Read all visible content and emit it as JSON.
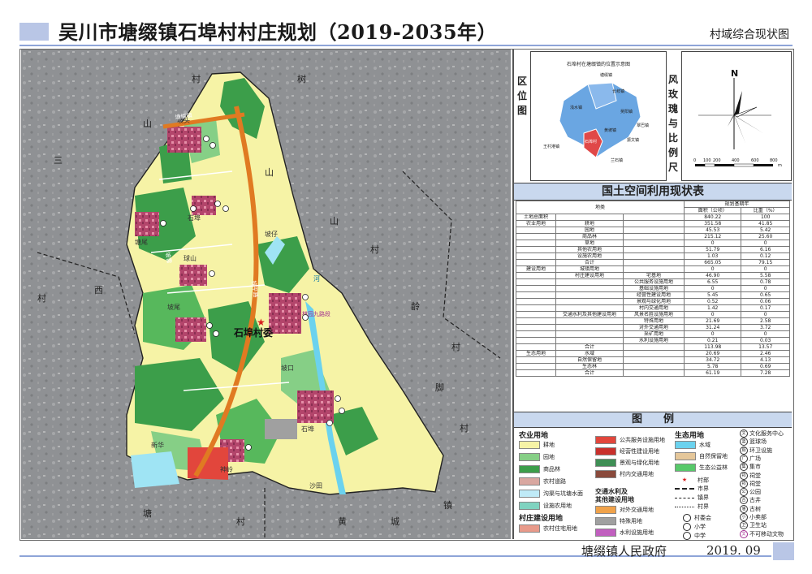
{
  "header": {
    "title": "吴川市塘缀镇石埠村村庄规划（2019-2035年）",
    "subtitle": "村域综合现状图"
  },
  "map": {
    "village_name": "石埠村委",
    "background_labels": [
      "村",
      "树",
      "山",
      "山",
      "山",
      "村",
      "村",
      "西",
      "龄",
      "村",
      "脚",
      "村",
      "塘",
      "村",
      "黄",
      "城",
      "镇",
      "三"
    ],
    "place_labels": [
      "坡头",
      "石埠",
      "塘尾",
      "球山",
      "坡尾",
      "坡仔",
      "坡口",
      "石埠",
      "新华",
      "神岭",
      "沙田"
    ],
    "river_label": "河",
    "road_labels": [
      "塘缀镇",
      "坡雷",
      "桂平路",
      "林园九路段"
    ],
    "colors": {
      "farmland": "#f6f3a6",
      "garden": "#86cf86",
      "forest": "#3c9e4a",
      "water": "#9fe4f4",
      "residential": "#b3456b",
      "road": "#e07a22",
      "outside": "#8f9194"
    }
  },
  "location": {
    "label_chars": [
      "区",
      "位",
      "图"
    ],
    "inset_title": "石埠村在塘缀镇的位置示意图",
    "places": [
      "塘缀镇",
      "长岐镇",
      "浅水镇",
      "吴阳镇",
      "覃巴镇",
      "振文镇",
      "黄坡镇",
      "王村港镇",
      "兰石镇",
      "石埠村"
    ]
  },
  "scale": {
    "label_chars": [
      "风",
      "玫",
      "瑰",
      "与",
      "比",
      "例",
      "尺"
    ],
    "north": "N",
    "ticks": [
      "0",
      "100",
      "200",
      "400",
      "600",
      "800"
    ],
    "unit": "m"
  },
  "table": {
    "title": "国土空间利用现状表",
    "col_header": "地类",
    "year_header": "规划基期年",
    "area_header": "面积（公顷）",
    "ratio_header": "比重（%）",
    "rows": [
      {
        "c1": "土地总面积",
        "c2": "",
        "c3": "",
        "area": "840.22",
        "ratio": "100"
      },
      {
        "c1": "农业用地",
        "c2": "耕地",
        "c3": "",
        "area": "351.58",
        "ratio": "41.85"
      },
      {
        "c1": "",
        "c2": "园地",
        "c3": "",
        "area": "45.53",
        "ratio": "5.42"
      },
      {
        "c1": "",
        "c2": "商品林",
        "c3": "",
        "area": "215.12",
        "ratio": "25.60"
      },
      {
        "c1": "",
        "c2": "草地",
        "c3": "",
        "area": "0",
        "ratio": "0"
      },
      {
        "c1": "",
        "c2": "其他农用地",
        "c3": "",
        "area": "51.79",
        "ratio": "6.16"
      },
      {
        "c1": "",
        "c2": "设施农用地",
        "c3": "",
        "area": "1.03",
        "ratio": "0.12"
      },
      {
        "c1": "",
        "c2": "合计",
        "c3": "",
        "area": "665.05",
        "ratio": "79.15"
      },
      {
        "c1": "建设用地",
        "c2": "城镇用地",
        "c3": "",
        "area": "0",
        "ratio": "0"
      },
      {
        "c1": "",
        "c2": "村庄建设用地",
        "c3": "宅基地",
        "area": "46.90",
        "ratio": "5.58"
      },
      {
        "c1": "",
        "c2": "",
        "c3": "公共服务设施用地",
        "area": "6.55",
        "ratio": "0.78"
      },
      {
        "c1": "",
        "c2": "",
        "c3": "基础设施用地",
        "area": "0",
        "ratio": "0"
      },
      {
        "c1": "",
        "c2": "",
        "c3": "经营性建设用地",
        "area": "5.45",
        "ratio": "0.65"
      },
      {
        "c1": "",
        "c2": "",
        "c3": "景观与绿化用地",
        "area": "0.52",
        "ordinal": "",
        "ratio": "0.06"
      },
      {
        "c1": "",
        "c2": "",
        "c3": "村内交通用地",
        "area": "1.42",
        "ratio": "0.17"
      },
      {
        "c1": "",
        "c2": "交通水利及其他建设用地",
        "c3": "风景名胜设施用地",
        "area": "0",
        "ratio": "0"
      },
      {
        "c1": "",
        "c2": "",
        "c3": "特殊用地",
        "area": "21.69",
        "ratio": "2.58"
      },
      {
        "c1": "",
        "c2": "",
        "c3": "对外交通用地",
        "area": "31.24",
        "ratio": "3.72"
      },
      {
        "c1": "",
        "c2": "",
        "c3": "采矿用地",
        "area": "0",
        "ratio": "0"
      },
      {
        "c1": "",
        "c2": "",
        "c3": "水利设施用地",
        "area": "0.21",
        "ratio": "0.03"
      },
      {
        "c1": "",
        "c2": "合计",
        "c3": "",
        "area": "113.98",
        "ratio": "13.57"
      },
      {
        "c1": "生态用地",
        "c2": "水域",
        "c3": "",
        "area": "20.69",
        "ratio": "2.46"
      },
      {
        "c1": "",
        "c2": "自然保留地",
        "c3": "",
        "area": "34.72",
        "ratio": "4.13"
      },
      {
        "c1": "",
        "c2": "生态林",
        "c3": "",
        "area": "5.78",
        "ratio": "0.69"
      },
      {
        "c1": "",
        "c2": "合计",
        "c3": "",
        "area": "61.19",
        "ratio": "7.28"
      }
    ]
  },
  "legend": {
    "title": "图　　例",
    "agri_heading": "农业用地",
    "agri": [
      {
        "label": "耕地",
        "color": "#f6f3a6"
      },
      {
        "label": "园地",
        "color": "#86cf86"
      },
      {
        "label": "商品林",
        "color": "#3c9e4a"
      },
      {
        "label": "农村道路",
        "color": "#d9a7a0"
      },
      {
        "label": "沟渠与坑塘水面",
        "color": "#bfeaf7"
      },
      {
        "label": "设施农用地",
        "color": "#7fd3c0"
      }
    ],
    "village_heading": "村庄建设用地",
    "village": [
      {
        "label": "农村住宅用地",
        "color": "#e89a8a"
      }
    ],
    "mid": [
      {
        "label": "公共服务设施用地",
        "color": "#e2463c"
      },
      {
        "label": "经营性建设用地",
        "color": "#c9302c"
      },
      {
        "label": "景观与绿化用地",
        "color": "#3f8f55"
      },
      {
        "label": "村内交通用地",
        "color": "#8a4a3c"
      }
    ],
    "transport_heading1": "交通水利及",
    "transport_heading2": "其他建设用地",
    "transport": [
      {
        "label": "对外交通用地",
        "color": "#f0a24a"
      },
      {
        "label": "特殊用地",
        "color": "#a0a0a0"
      },
      {
        "label": "水利设施用地",
        "color": "#c15fbf"
      }
    ],
    "eco_heading": "生态用地",
    "eco": [
      {
        "label": "水域",
        "color": "#6bd2ee"
      },
      {
        "label": "自然保留地",
        "color": "#e5c79a"
      },
      {
        "label": "生态公益林",
        "color": "#57c96a"
      }
    ],
    "lines": [
      {
        "label": "村部"
      },
      {
        "label": "市界"
      },
      {
        "label": "镇界"
      },
      {
        "label": "村界"
      }
    ],
    "lines_extra": [
      {
        "label": "村委会"
      },
      {
        "label": "小学"
      },
      {
        "label": "中学"
      }
    ],
    "symbols": [
      {
        "glyph": "文",
        "label": "文化服务中心"
      },
      {
        "glyph": "篮",
        "label": "篮球场"
      },
      {
        "glyph": "厕",
        "label": "环卫设施"
      },
      {
        "glyph": "广",
        "label": "广场"
      },
      {
        "glyph": "集",
        "label": "集市"
      },
      {
        "glyph": "祠",
        "label": "祠堂"
      },
      {
        "glyph": "祠",
        "label": "祠堂"
      },
      {
        "glyph": "公",
        "label": "公园"
      },
      {
        "glyph": "古",
        "label": "古井"
      },
      {
        "glyph": "庙",
        "label": "古树"
      },
      {
        "glyph": "小",
        "label": "小卖部"
      },
      {
        "glyph": "卫",
        "label": "卫生站"
      },
      {
        "glyph": "文",
        "label": "不可移动文物"
      }
    ]
  },
  "footer": {
    "org": "塘缀镇人民政府",
    "date": "2019. 09"
  }
}
